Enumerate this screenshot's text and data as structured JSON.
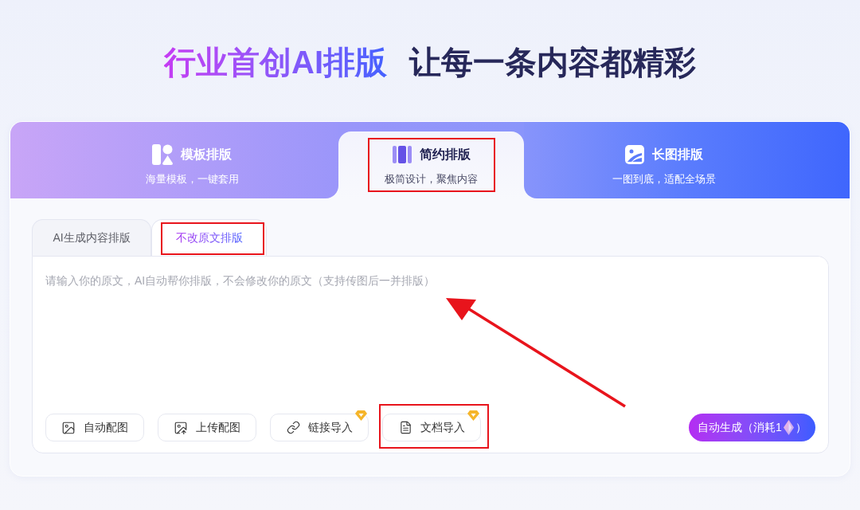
{
  "headline": {
    "highlight": "行业首创AI排版",
    "rest": "让每一条内容都精彩"
  },
  "mode_tabs": [
    {
      "kind": "template",
      "title": "模板排版",
      "subtitle": "海量模板，一键套用",
      "selected": false,
      "highlighted": false
    },
    {
      "kind": "columns",
      "title": "简约排版",
      "subtitle": "极简设计，聚焦内容",
      "selected": true,
      "highlighted": true
    },
    {
      "kind": "picture",
      "title": "长图排版",
      "subtitle": "一图到底，适配全场景",
      "selected": false,
      "highlighted": false
    }
  ],
  "sub_tabs": [
    {
      "label": "AI生成内容排版",
      "selected": false,
      "highlighted": false
    },
    {
      "label": "不改原文排版",
      "selected": true,
      "highlighted": true
    }
  ],
  "editor": {
    "placeholder": "请输入你的原文，AI自动帮你排版，不会修改你的原文（支持传图后一并排版）",
    "arrow": true
  },
  "tools": [
    {
      "kind": "image",
      "label": "自动配图",
      "premium": false,
      "highlighted": false
    },
    {
      "kind": "upload",
      "label": "上传配图",
      "premium": false,
      "highlighted": false
    },
    {
      "kind": "link",
      "label": "链接导入",
      "premium": true,
      "highlighted": false
    },
    {
      "kind": "document",
      "label": "文档导入",
      "premium": true,
      "highlighted": true
    }
  ],
  "generate_button": {
    "label": "自动生成（消耗1",
    "suffix": "）"
  }
}
